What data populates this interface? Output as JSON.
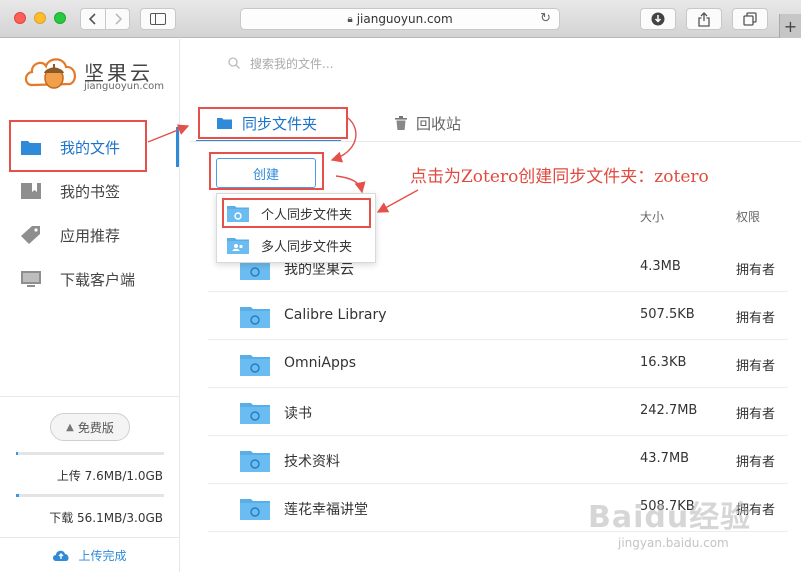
{
  "browser": {
    "url": "jianguoyun.com",
    "new_tab_label": "+"
  },
  "logo": {
    "name": "坚果云",
    "domain": "jianguoyun.com"
  },
  "search": {
    "placeholder": "搜索我的文件..."
  },
  "sidebar": {
    "items": [
      {
        "label": "我的文件",
        "icon": "folder-icon",
        "active": true
      },
      {
        "label": "我的书签",
        "icon": "bookmark-icon",
        "active": false
      },
      {
        "label": "应用推荐",
        "icon": "tag-icon",
        "active": false
      },
      {
        "label": "下载客户端",
        "icon": "monitor-icon",
        "active": false
      }
    ],
    "plan_label": "免费版",
    "upload_quota": "上传 7.6MB/1.0GB",
    "upload_fraction": 0.0076,
    "download_quota": "下载 56.1MB/3.0GB",
    "download_fraction": 0.0183,
    "upload_status": "上传完成"
  },
  "tabs": [
    {
      "label": "同步文件夹",
      "active": true
    },
    {
      "label": "回收站",
      "active": false
    }
  ],
  "create_button": "创建",
  "create_menu": [
    {
      "label": "个人同步文件夹",
      "icon": "sync-folder-icon"
    },
    {
      "label": "多人同步文件夹",
      "icon": "shared-folder-icon"
    }
  ],
  "table": {
    "columns": {
      "size": "大小",
      "permission": "权限"
    },
    "rows": [
      {
        "name": "我的坚果云",
        "size": "4.3MB",
        "permission": "拥有者"
      },
      {
        "name": "Calibre Library",
        "size": "507.5KB",
        "permission": "拥有者"
      },
      {
        "name": "OmniApps",
        "size": "16.3KB",
        "permission": "拥有者"
      },
      {
        "name": "读书",
        "size": "242.7MB",
        "permission": "拥有者"
      },
      {
        "name": "技术资料",
        "size": "43.7MB",
        "permission": "拥有者"
      },
      {
        "name": "莲花幸福讲堂",
        "size": "508.7KB",
        "permission": "拥有者"
      }
    ]
  },
  "annotation": {
    "text": "点击为Zotero创建同步文件夹：zotero",
    "color": "#e6504a"
  },
  "watermark": {
    "main": "Baidu经验",
    "sub": "jingyan.baidu.com"
  },
  "colors": {
    "accent": "#2f8ad8",
    "folder": "#5aaee8",
    "annotation": "#e6504a"
  }
}
